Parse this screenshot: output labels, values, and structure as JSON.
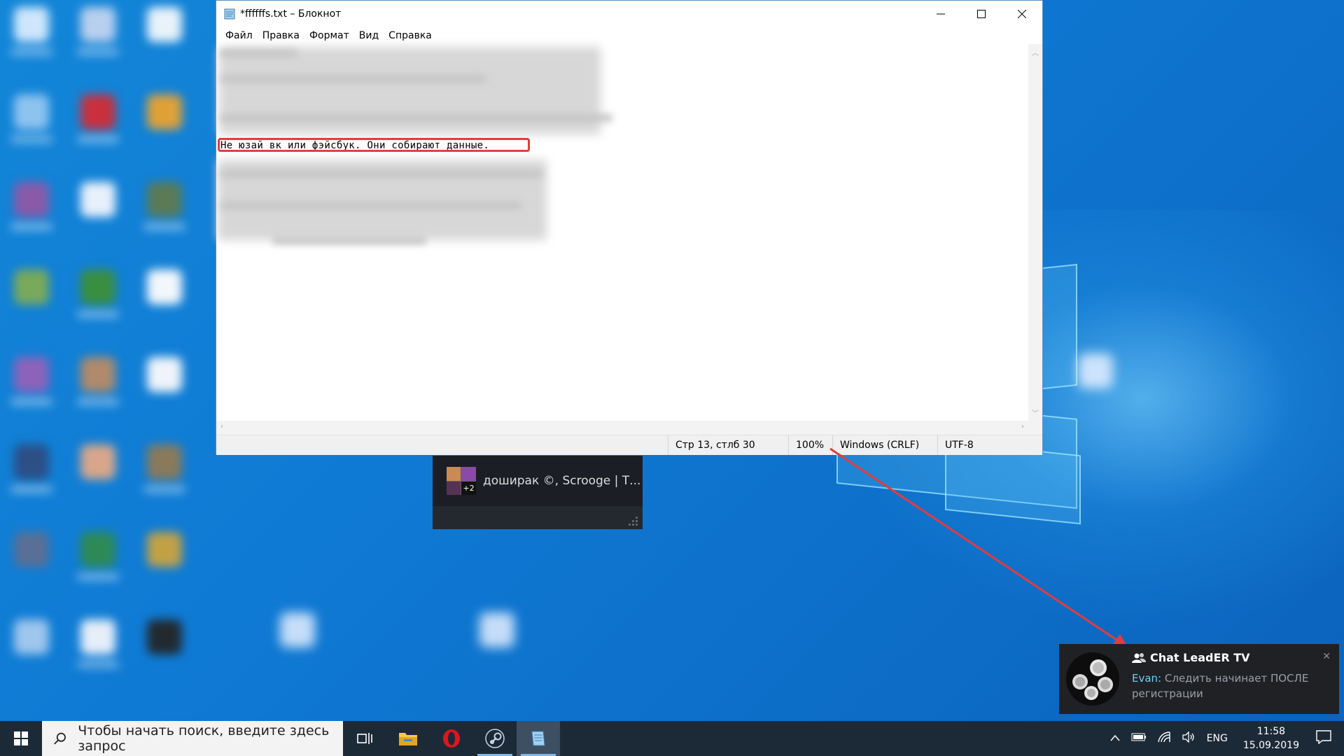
{
  "notepad": {
    "title": "*ffffffs.txt – Блокнот",
    "menu": [
      "Файл",
      "Правка",
      "Формат",
      "Вид",
      "Справка"
    ],
    "highlighted_line": "Не юзай вк или фэйсбук. Они собирают данные.",
    "status": {
      "position": "Стр 13, стлб 30",
      "zoom": "100%",
      "line_endings": "Windows (CRLF)",
      "encoding": "UTF-8"
    }
  },
  "steam_thumbnail": {
    "label": "доширак ©, Scrooge | Т...",
    "extra_count": "+2"
  },
  "toast": {
    "title": "Chat LeadER TV",
    "user": "Evan:",
    "message": " Следить начинает ПОСЛЕ регистрации"
  },
  "taskbar": {
    "search_placeholder": "Чтобы начать поиск, введите здесь запрос",
    "language": "ENG",
    "time": "11:58",
    "date": "15.09.2019"
  },
  "colors": {
    "highlight": "#e23c3c",
    "arrow": "#e23c3c",
    "taskbar": "#1c2a38",
    "toast_bg": "#1f2125",
    "toast_user": "#6dcff6"
  },
  "icons": [
    "notepad-icon",
    "minimize-icon",
    "maximize-icon",
    "close-icon",
    "windows-start-icon",
    "search-icon",
    "task-view-icon",
    "file-explorer-icon",
    "opera-icon",
    "steam-icon",
    "notepad-taskbar-icon",
    "chevron-up-icon",
    "battery-icon",
    "wifi-icon",
    "volume-icon",
    "notification-center-icon",
    "friends-icon"
  ]
}
